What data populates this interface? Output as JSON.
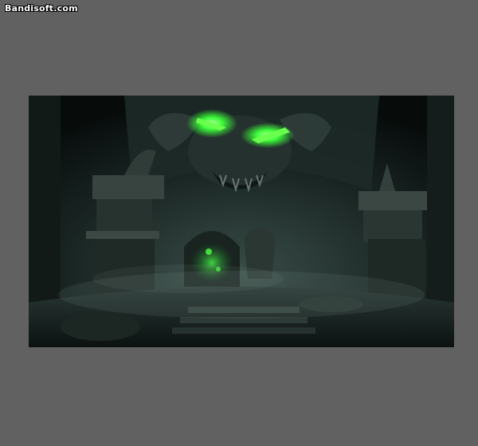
{
  "watermark": {
    "text": "Bandisoft.com"
  },
  "colors": {
    "background": "#616161",
    "scene_dark": "#0d1614",
    "scene_mid": "#2b3a37",
    "glow_green": "#3dff3a"
  },
  "image": {
    "description_icon": "dungeon-scene-image"
  }
}
